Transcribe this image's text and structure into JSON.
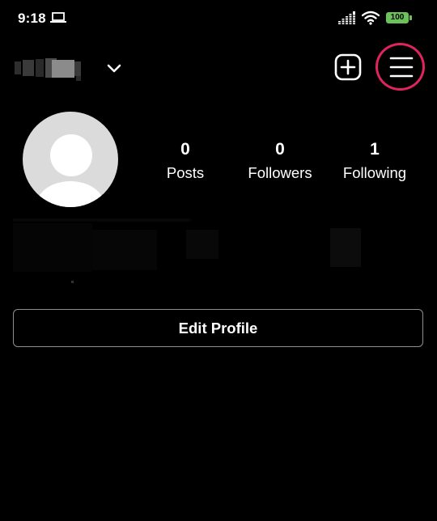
{
  "status_bar": {
    "time": "9:18",
    "battery_level": "100",
    "icons": [
      "laptop-icon",
      "signal-icon",
      "wifi-icon",
      "battery-icon"
    ],
    "battery_color": "#6ac259"
  },
  "header": {
    "username": "",
    "icons": [
      "chevron-down-icon",
      "create-icon",
      "menu-icon"
    ],
    "highlight_color": "#e0245e"
  },
  "profile": {
    "stats": [
      {
        "value": "0",
        "label": "Posts"
      },
      {
        "value": "0",
        "label": "Followers"
      },
      {
        "value": "1",
        "label": "Following"
      }
    ],
    "avatar_icon": "default-avatar-icon"
  },
  "actions": {
    "edit_profile_label": "Edit Profile"
  }
}
